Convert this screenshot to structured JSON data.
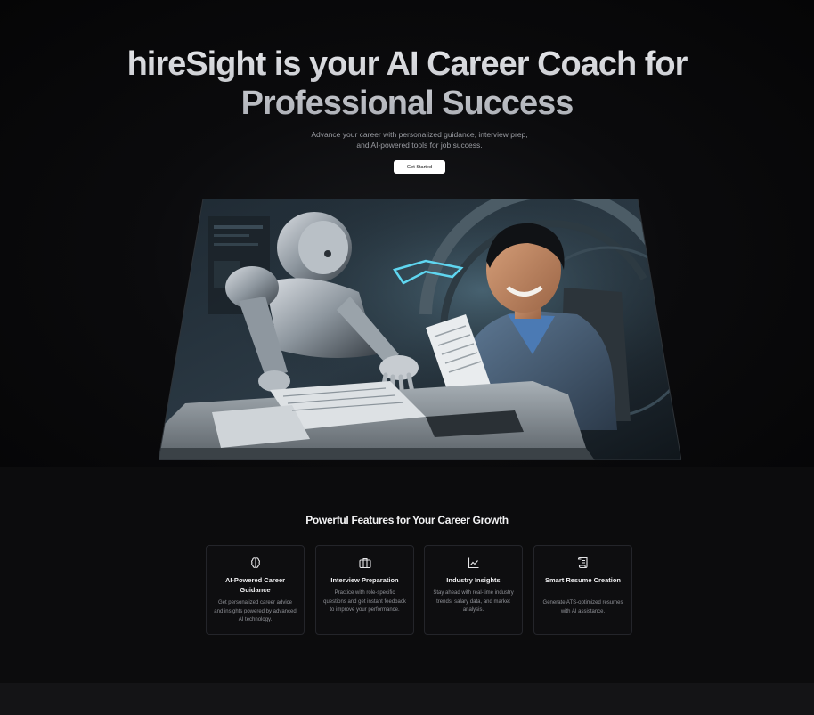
{
  "hero": {
    "title_line1": "hireSight is your AI Career Coach for",
    "title_line2": "Professional Success",
    "subtitle": "Advance your career with personalized guidance, interview prep, and AI-powered tools for job success.",
    "cta_label": "Get Started"
  },
  "features": {
    "title": "Powerful Features for Your Career Growth",
    "cards": [
      {
        "icon": "brain-icon",
        "title": "AI-Powered Career Guidance",
        "description": "Get personalized career advice and insights powered by advanced AI technology."
      },
      {
        "icon": "briefcase-icon",
        "title": "Interview Preparation",
        "description": "Practice with role-specific questions and get instant feedback to improve your performance."
      },
      {
        "icon": "line-chart-icon",
        "title": "Industry Insights",
        "description": "Stay ahead with real-time industry trends, salary data, and market analysis."
      },
      {
        "icon": "scroll-text-icon",
        "title": "Smart Resume Creation",
        "description": "Generate ATS-optimized resumes with AI assistance."
      }
    ]
  },
  "colors": {
    "background": "#0a0a0b",
    "card_border": "#24252a",
    "cta_background": "#ffffff",
    "accent_cyan": "#5fd6f0"
  }
}
